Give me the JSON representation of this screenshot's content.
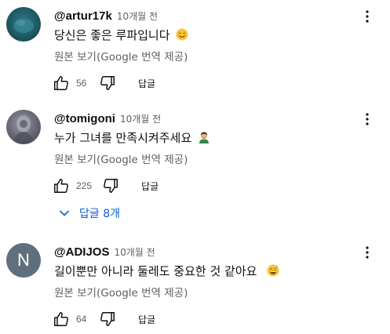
{
  "comments": [
    {
      "author": "@artur17k",
      "time": "10개월 전",
      "text": "당신은 좋은 루파입니다",
      "emoji": "smiling-face",
      "translate_label": "원본 보기(Google 번역 제공)",
      "likes": "56",
      "reply_label": "답글"
    },
    {
      "author": "@tomigoni",
      "time": "10개월 전",
      "text": "누가 그녀를 만족시켜주세요",
      "emoji": "person-facepalming",
      "translate_label": "원본 보기(Google 번역 제공)",
      "likes": "225",
      "reply_label": "답글"
    },
    {
      "author": "@ADIJOS",
      "avatar_letter": "N",
      "time": "10개월 전",
      "text": "길이뿐만 아니라 둘레도 중요한 것 같아요",
      "emoji": "grinning-sweat",
      "translate_label": "원본 보기(Google 번역 제공)",
      "likes": "64",
      "reply_label": "답글"
    }
  ],
  "replies_toggle": {
    "label": "답글 8개"
  },
  "colors": {
    "link": "#065fd4",
    "secondary": "#606060",
    "text": "#0f0f0f"
  }
}
